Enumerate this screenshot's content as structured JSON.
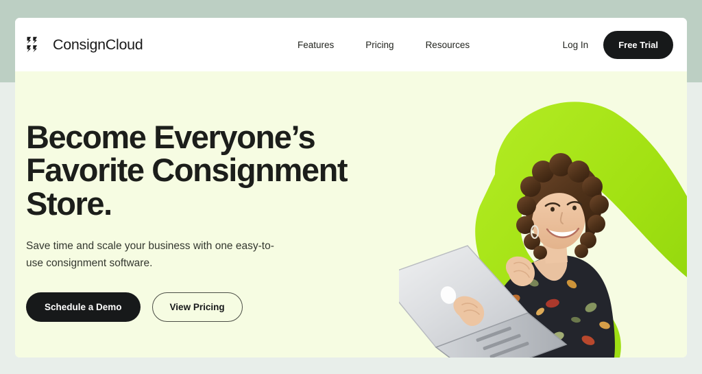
{
  "theme": {
    "page_bg": "#e8eeea",
    "band_bg": "#bccfc3",
    "nav_bg": "#ffffff",
    "hero_bg": "#f6fce2",
    "accent_green": "#a6e418",
    "accent_green_dark": "#8fd40c",
    "ink": "#17191a"
  },
  "navbar": {
    "brand": {
      "name": "ConsignCloud",
      "logo_icon": "consigncloud-chevrons-logo"
    },
    "links": [
      {
        "label": "Features"
      },
      {
        "label": "Pricing"
      },
      {
        "label": "Resources"
      }
    ],
    "login_label": "Log In",
    "cta_label": "Free Trial"
  },
  "hero": {
    "headline": "Become Everyone’s Favorite Consignment Store.",
    "subhead": "Save time and scale your business with one easy-to-use consignment software.",
    "primary_cta": "Schedule a Demo",
    "secondary_cta": "View Pricing",
    "artwork": {
      "description": "Smiling woman with curly brown hair holding an open silver laptop, in front of a lime-green swoosh shape",
      "shape_name": "green-swoosh"
    }
  }
}
